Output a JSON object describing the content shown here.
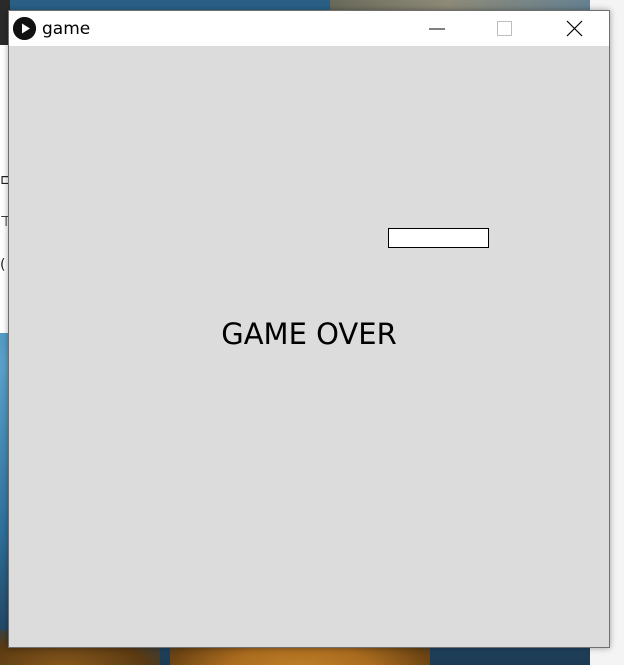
{
  "window": {
    "title": "game",
    "app_icon": "play-circle-icon",
    "controls": {
      "minimize_icon": "minimize-icon",
      "maximize_icon": "maximize-icon",
      "close_icon": "close-icon"
    }
  },
  "game": {
    "message": "GAME OVER",
    "background_color": "#dcdcdc",
    "paddle_color": "#ffffff"
  }
}
